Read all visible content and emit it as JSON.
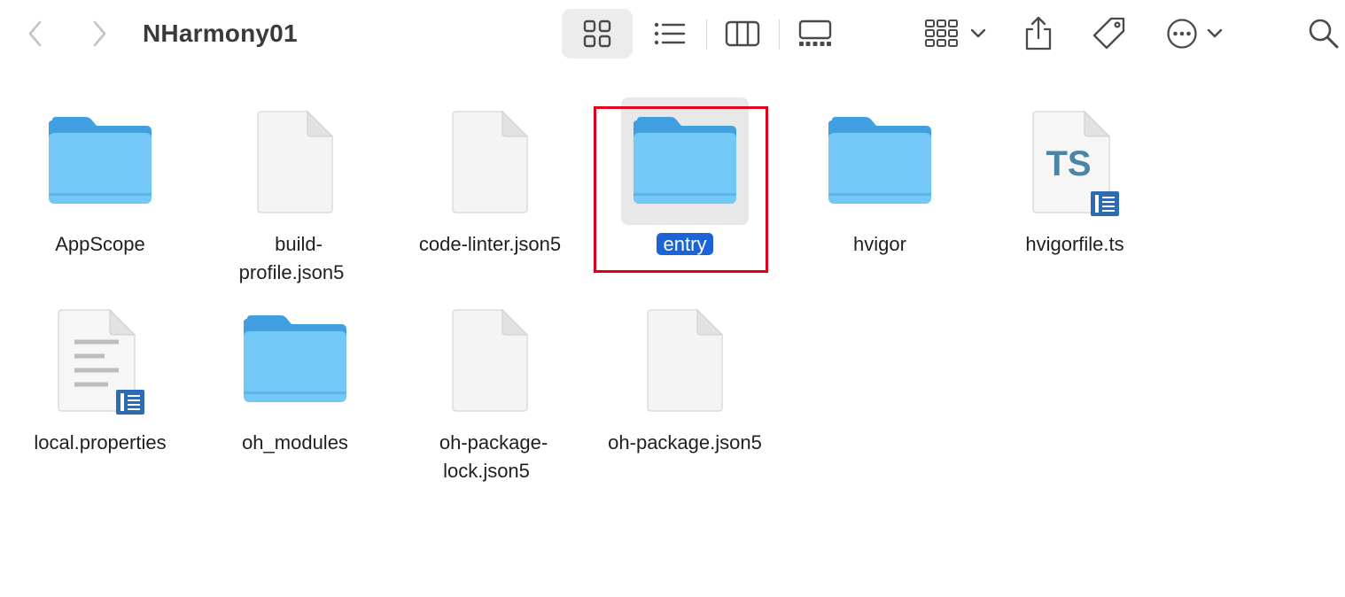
{
  "window": {
    "title": "NHarmony01"
  },
  "toolbar": {
    "back_icon": "chevron-left-icon",
    "forward_icon": "chevron-right-icon",
    "views": [
      "icon-view-icon",
      "list-view-icon",
      "column-view-icon",
      "gallery-view-icon"
    ],
    "active_view": "icon-view-icon",
    "group_icon": "group-grid-icon",
    "share_icon": "share-icon",
    "tag_icon": "tag-icon",
    "more_icon": "ellipsis-circle-icon",
    "search_icon": "search-icon"
  },
  "files": [
    {
      "name": "AppScope",
      "kind": "folder"
    },
    {
      "name": "build-\nprofile.json5",
      "kind": "document"
    },
    {
      "name": "code-linter.json5",
      "kind": "document"
    },
    {
      "name": "entry",
      "kind": "folder",
      "selected": true
    },
    {
      "name": "hvigor",
      "kind": "folder"
    },
    {
      "name": "hvigorfile.ts",
      "kind": "typescript",
      "badge": "TS"
    },
    {
      "name": "local.properties",
      "kind": "text-document"
    },
    {
      "name": "oh_modules",
      "kind": "folder"
    },
    {
      "name": "oh-package-\nlock.json5",
      "kind": "document"
    },
    {
      "name": "oh-package.json5",
      "kind": "document"
    }
  ],
  "colors": {
    "folder_top": "#3f9fe0",
    "folder_body": "#74c8f7",
    "selection": "#1a64d6",
    "highlight_box": "#e0001b"
  }
}
